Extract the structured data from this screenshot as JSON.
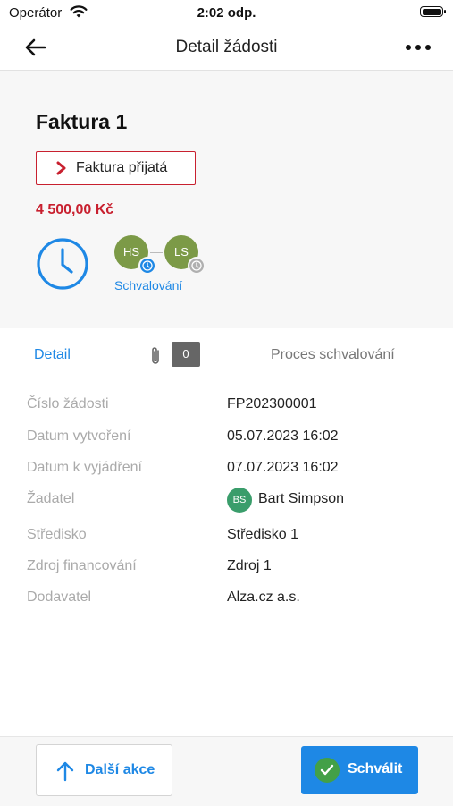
{
  "status_bar": {
    "carrier": "Operátor",
    "time": "2:02 odp."
  },
  "nav": {
    "title": "Detail žádosti",
    "back_icon": "arrow-left-icon",
    "more_icon": "more-horizontal-icon"
  },
  "request": {
    "title": "Faktura 1",
    "status": "Faktura přijatá",
    "amount": "4 500,00 Kč",
    "approvers": [
      {
        "initials": "HS",
        "state_icon": "clock-icon"
      },
      {
        "initials": "LS",
        "state_icon": "clock-icon"
      }
    ],
    "approval_label": "Schvalování"
  },
  "tabs": {
    "detail": "Detail",
    "attachments_count": "0",
    "process": "Proces schvalování"
  },
  "fields": [
    {
      "label": "Číslo žádosti",
      "value": "FP202300001"
    },
    {
      "label": "Datum vytvoření",
      "value": "05.07.2023 16:02"
    },
    {
      "label": "Datum k vyjádření",
      "value": "07.07.2023 16:02"
    },
    {
      "label": "Žadatel",
      "value": "Bart Simpson",
      "avatar": "BS"
    },
    {
      "label": "Středisko",
      "value": "Středisko 1"
    },
    {
      "label": "Zdroj financování",
      "value": "Zdroj 1"
    },
    {
      "label": "Dodavatel",
      "value": "Alza.cz a.s."
    }
  ],
  "actions": {
    "more": "Další akce",
    "approve": "Schválit"
  },
  "colors": {
    "accent": "#1e88e5",
    "status_red": "#c8202f",
    "approver_green": "#7c9a47",
    "approve_check": "#43a047"
  }
}
